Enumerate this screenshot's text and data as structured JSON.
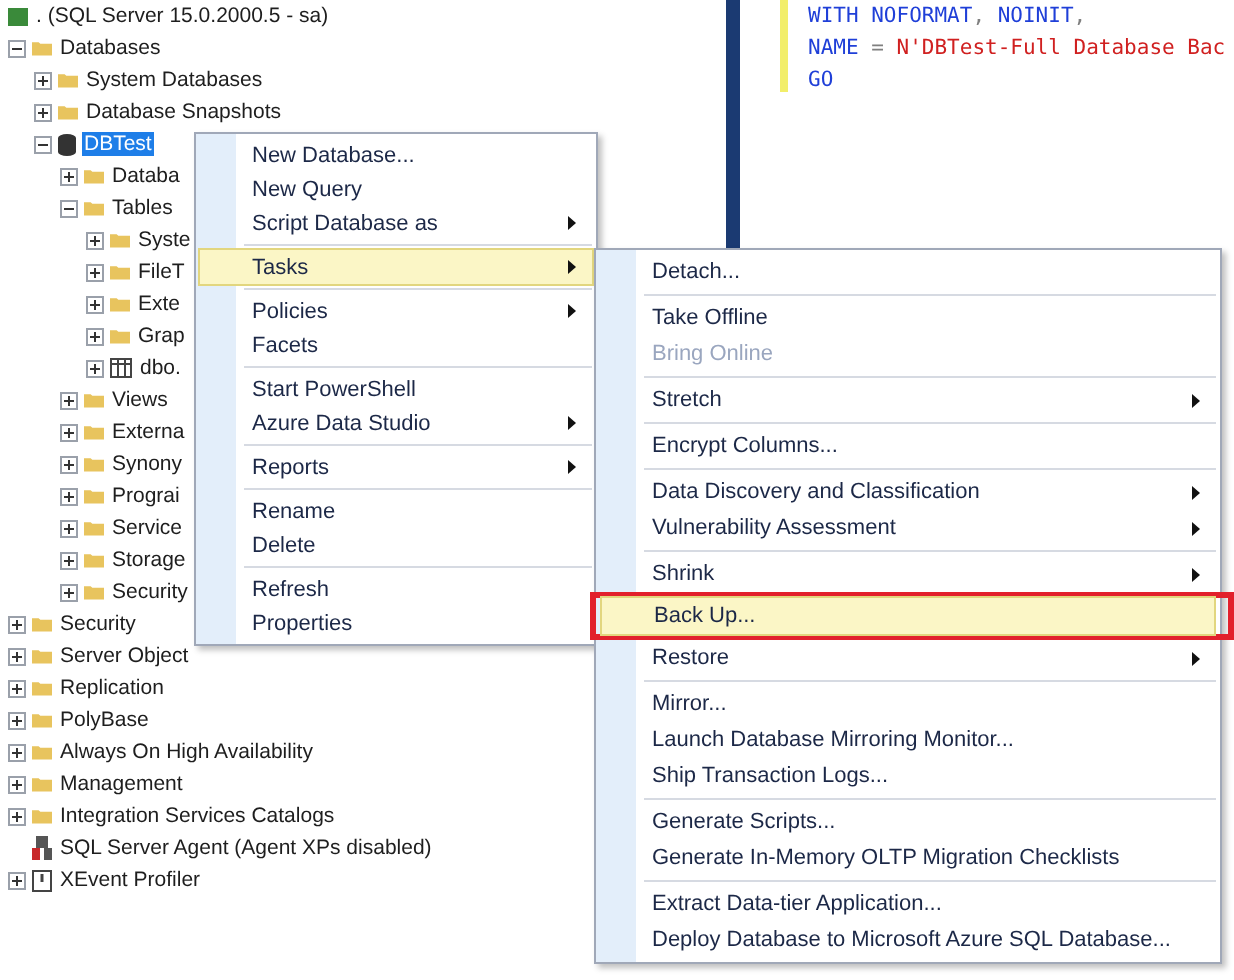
{
  "tree": [
    {
      "label": ". (SQL Server 15.0.2000.5 - sa)",
      "kind": "server",
      "selected": false,
      "children": [
        {
          "label": "Databases",
          "kind": "folder",
          "expanded": true,
          "selected": false,
          "children": [
            {
              "label": "System Databases",
              "kind": "folder",
              "expanded": false,
              "selected": false
            },
            {
              "label": "Database Snapshots",
              "kind": "folder",
              "expanded": false,
              "selected": false
            },
            {
              "label": "DBTest",
              "kind": "database",
              "expanded": true,
              "selected": true,
              "children": [
                {
                  "label": "Databa",
                  "kind": "folder",
                  "expanded": false,
                  "selected": false
                },
                {
                  "label": "Tables",
                  "kind": "folder",
                  "expanded": true,
                  "selected": false,
                  "children": [
                    {
                      "label": "Syste",
                      "kind": "folder",
                      "expanded": false,
                      "selected": false
                    },
                    {
                      "label": "FileT",
                      "kind": "folder",
                      "expanded": false,
                      "selected": false
                    },
                    {
                      "label": "Exte",
                      "kind": "folder",
                      "expanded": false,
                      "selected": false
                    },
                    {
                      "label": "Grap",
                      "kind": "folder",
                      "expanded": false,
                      "selected": false
                    },
                    {
                      "label": "dbo.",
                      "kind": "table",
                      "expanded": false,
                      "selected": false
                    }
                  ]
                },
                {
                  "label": "Views",
                  "kind": "folder",
                  "expanded": false,
                  "selected": false
                },
                {
                  "label": "Externa",
                  "kind": "folder",
                  "expanded": false,
                  "selected": false
                },
                {
                  "label": "Synony",
                  "kind": "folder",
                  "expanded": false,
                  "selected": false
                },
                {
                  "label": "Prograi",
                  "kind": "folder",
                  "expanded": false,
                  "selected": false
                },
                {
                  "label": "Service",
                  "kind": "folder",
                  "expanded": false,
                  "selected": false
                },
                {
                  "label": "Storage",
                  "kind": "folder",
                  "expanded": false,
                  "selected": false
                },
                {
                  "label": "Security",
                  "kind": "folder",
                  "expanded": false,
                  "selected": false
                }
              ]
            }
          ]
        },
        {
          "label": "Security",
          "kind": "folder",
          "expanded": false,
          "selected": false
        },
        {
          "label": "Server Object",
          "kind": "folder",
          "expanded": false,
          "selected": false
        },
        {
          "label": "Replication",
          "kind": "folder",
          "expanded": false,
          "selected": false
        },
        {
          "label": "PolyBase",
          "kind": "folder",
          "expanded": false,
          "selected": false
        },
        {
          "label": "Always On High Availability",
          "kind": "folder",
          "expanded": false,
          "selected": false
        },
        {
          "label": "Management",
          "kind": "folder",
          "expanded": false,
          "selected": false
        },
        {
          "label": "Integration Services Catalogs",
          "kind": "folder",
          "expanded": false,
          "selected": false
        },
        {
          "label": "SQL Server Agent (Agent XPs disabled)",
          "kind": "agent",
          "selected": false
        },
        {
          "label": "XEvent Profiler",
          "kind": "profiler",
          "expanded": false,
          "selected": false
        }
      ]
    }
  ],
  "editor": {
    "lines": [
      [
        {
          "kind": "keyword",
          "text": "WITH NOFORMAT"
        },
        {
          "kind": "operator",
          "text": ", "
        },
        {
          "kind": "keyword",
          "text": "NOINIT"
        },
        {
          "kind": "operator",
          "text": ","
        }
      ],
      [
        {
          "kind": "keyword",
          "text": "NAME"
        },
        {
          "kind": "operator",
          "text": " = "
        },
        {
          "kind": "string",
          "text": "N'DBTest-Full Database Bac"
        }
      ],
      [
        {
          "kind": "keyword",
          "text": "GO"
        }
      ]
    ]
  },
  "context_menu": {
    "groups": [
      [
        {
          "label": "New Database...",
          "selected": false,
          "submenu": false
        },
        {
          "label": "New Query",
          "selected": false,
          "submenu": false
        },
        {
          "label": "Script Database as",
          "selected": false,
          "submenu": true
        }
      ],
      [
        {
          "label": "Tasks",
          "selected": true,
          "submenu": true
        }
      ],
      [
        {
          "label": "Policies",
          "selected": false,
          "submenu": true
        },
        {
          "label": "Facets",
          "selected": false,
          "submenu": false
        }
      ],
      [
        {
          "label": "Start PowerShell",
          "selected": false,
          "submenu": false
        },
        {
          "label": "Azure Data Studio",
          "selected": false,
          "submenu": true
        }
      ],
      [
        {
          "label": "Reports",
          "selected": false,
          "submenu": true
        }
      ],
      [
        {
          "label": "Rename",
          "selected": false,
          "submenu": false
        },
        {
          "label": "Delete",
          "selected": false,
          "submenu": false
        }
      ],
      [
        {
          "label": "Refresh",
          "selected": false,
          "submenu": false
        },
        {
          "label": "Properties",
          "selected": false,
          "submenu": false
        }
      ]
    ]
  },
  "tasks_submenu": {
    "groups": [
      [
        {
          "label": "Detach...",
          "selected": false,
          "submenu": false,
          "disabled": false
        }
      ],
      [
        {
          "label": "Take Offline",
          "selected": false,
          "submenu": false,
          "disabled": false
        },
        {
          "label": "Bring Online",
          "selected": false,
          "submenu": false,
          "disabled": true
        }
      ],
      [
        {
          "label": "Stretch",
          "selected": false,
          "submenu": true,
          "disabled": false
        }
      ],
      [
        {
          "label": "Encrypt Columns...",
          "selected": false,
          "submenu": false,
          "disabled": false
        }
      ],
      [
        {
          "label": "Data Discovery and Classification",
          "selected": false,
          "submenu": true,
          "disabled": false
        },
        {
          "label": "Vulnerability Assessment",
          "selected": false,
          "submenu": true,
          "disabled": false
        }
      ],
      [
        {
          "label": "Shrink",
          "selected": false,
          "submenu": true,
          "disabled": false
        },
        {
          "label": "Back Up...",
          "selected": true,
          "submenu": false,
          "disabled": false
        },
        {
          "label": "Restore",
          "selected": false,
          "submenu": true,
          "disabled": false
        }
      ],
      [
        {
          "label": "Mirror...",
          "selected": false,
          "submenu": false,
          "disabled": false
        },
        {
          "label": "Launch Database Mirroring Monitor...",
          "selected": false,
          "submenu": false,
          "disabled": false
        },
        {
          "label": "Ship Transaction Logs...",
          "selected": false,
          "submenu": false,
          "disabled": false
        }
      ],
      [
        {
          "label": "Generate Scripts...",
          "selected": false,
          "submenu": false,
          "disabled": false
        },
        {
          "label": "Generate In-Memory OLTP Migration Checklists",
          "selected": false,
          "submenu": false,
          "disabled": false
        }
      ],
      [
        {
          "label": "Extract Data-tier Application...",
          "selected": false,
          "submenu": false,
          "disabled": false
        },
        {
          "label": "Deploy Database to Microsoft Azure SQL Database...",
          "selected": false,
          "submenu": false,
          "disabled": false
        }
      ]
    ]
  }
}
